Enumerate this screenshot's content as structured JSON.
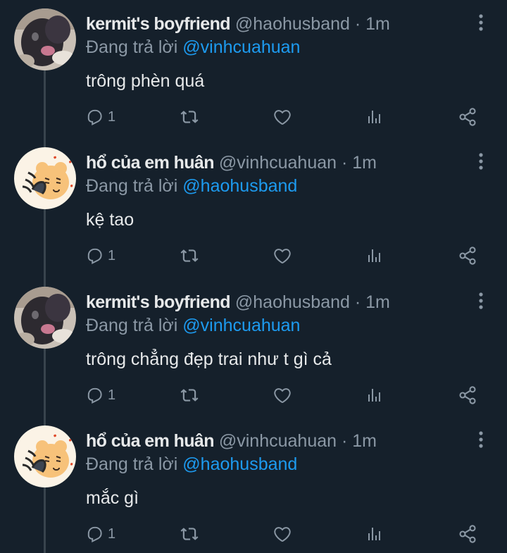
{
  "replying_prefix": "Đang trả lời",
  "tweets": [
    {
      "name": "kermit's boyfriend",
      "handle": "@haohusband",
      "separator": "·",
      "time": "1m",
      "reply_to": "@vinhcuahuan",
      "text": "trông phèn quá",
      "reply_count": "1",
      "avatar": "cat-photo-avatar"
    },
    {
      "name": "hổ của em huân",
      "handle": "@vinhcuahuan",
      "separator": "·",
      "time": "1m",
      "reply_to": "@haohusband",
      "text": "kệ tao",
      "reply_count": "1",
      "avatar": "tiger-cartoon-avatar"
    },
    {
      "name": "kermit's boyfriend",
      "handle": "@haohusband",
      "separator": "·",
      "time": "1m",
      "reply_to": "@vinhcuahuan",
      "text": "trông chẳng đẹp trai như t gì cả",
      "reply_count": "1",
      "avatar": "cat-photo-avatar"
    },
    {
      "name": "hổ của em huân",
      "handle": "@vinhcuahuan",
      "separator": "·",
      "time": "1m",
      "reply_to": "@haohusband",
      "text": "mắc gì",
      "reply_count": "1",
      "avatar": "tiger-cartoon-avatar"
    }
  ],
  "colors": {
    "background": "#15202b",
    "text_primary": "#e7e9ea",
    "text_secondary": "#8b98a5",
    "mention": "#1d9bf0",
    "thread_line": "#38444d"
  }
}
